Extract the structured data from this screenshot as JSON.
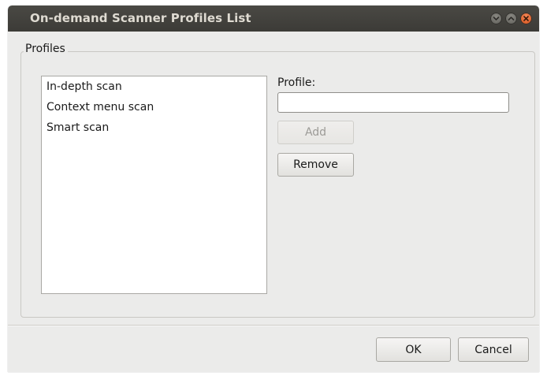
{
  "window": {
    "title": "On-demand Scanner Profiles List",
    "controls": [
      "minimize-icon",
      "maximize-icon",
      "close-icon"
    ]
  },
  "profiles_group": {
    "label": "Profiles",
    "list_items": [
      "In-depth scan",
      "Context menu scan",
      "Smart scan"
    ]
  },
  "profile_field": {
    "label": "Profile:",
    "value": "",
    "placeholder": ""
  },
  "buttons": {
    "add": "Add",
    "remove": "Remove",
    "ok": "OK",
    "cancel": "Cancel"
  },
  "colors": {
    "titlebar": "#3c3b37",
    "window_bg": "#ebebea",
    "close_button": "#e05a1f"
  }
}
